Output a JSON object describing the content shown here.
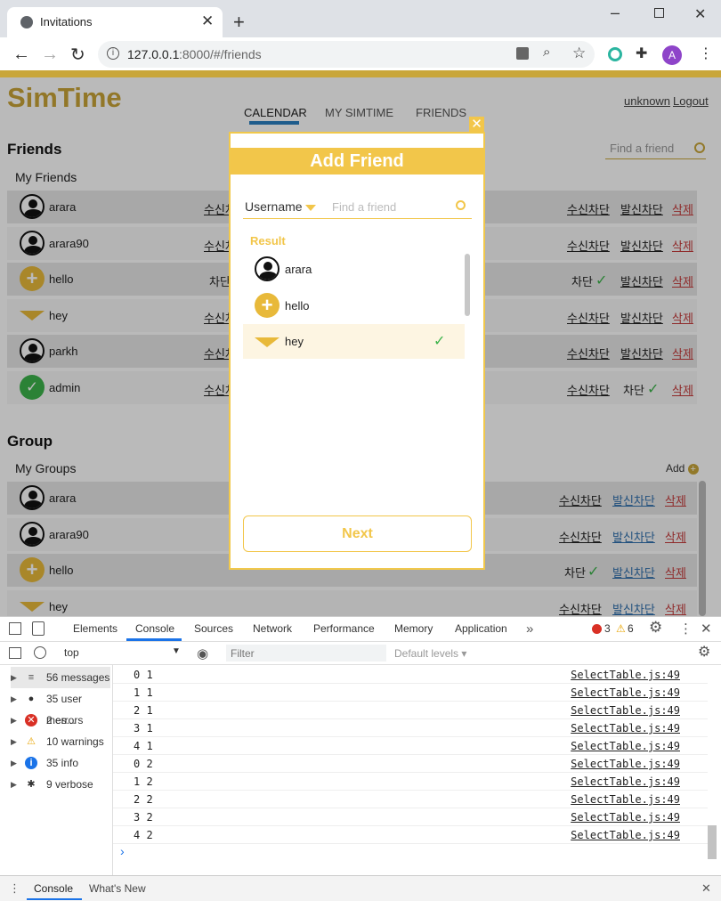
{
  "browser": {
    "tab_title": "Invitations",
    "url_host": "127.0.0.1",
    "url_path": ":8000/#/friends",
    "avatar_letter": "A"
  },
  "app": {
    "logo": "SimTime",
    "nav": [
      "CALENDAR",
      "MY SIMTIME",
      "FRIENDS"
    ],
    "user_link": "unknown",
    "logout_link": "Logout",
    "friends_title": "Friends",
    "my_friends": "My Friends",
    "find_placeholder": "Find a friend",
    "friends": [
      {
        "name": "arara",
        "avatar": "person",
        "a1": "수신차단",
        "b1": "수신차단",
        "b2": "발신차단",
        "b3": "삭제"
      },
      {
        "name": "arara90",
        "avatar": "person",
        "a1": "수신차",
        "b1": "수신차단",
        "b2": "발신차단",
        "b3": "삭제"
      },
      {
        "name": "hello",
        "avatar": "plus",
        "a1": "차단",
        "b1": "차단",
        "b2": "발신차단",
        "b3": "삭제"
      },
      {
        "name": "hey",
        "avatar": "arrow",
        "a1": "수신차",
        "b1": "수신차단",
        "b2": "발신차단",
        "b3": "삭제"
      },
      {
        "name": "parkh",
        "avatar": "person",
        "a1": "수신차",
        "b1": "수신차단",
        "b2": "발신차단",
        "b3": "삭제"
      },
      {
        "name": "admin",
        "avatar": "check",
        "a1": "수신차",
        "b1": "수신차단",
        "b2": "차단",
        "b3": "삭제"
      }
    ],
    "group_title": "Group",
    "my_groups": "My Groups",
    "add_label": "Add",
    "groups": [
      {
        "name": "arara",
        "avatar": "person",
        "b1": "수신차단",
        "b2": "발신차단",
        "b3": "삭제"
      },
      {
        "name": "arara90",
        "avatar": "person",
        "b1": "수신차단",
        "b2": "발신차단",
        "b3": "삭제"
      },
      {
        "name": "hello",
        "avatar": "plus",
        "b1": "차단",
        "b2": "발신차단",
        "b3": "삭제"
      },
      {
        "name": "hey",
        "avatar": "arrow",
        "b1": "수신차단",
        "b2": "발신차단",
        "b3": "삭제"
      }
    ]
  },
  "modal": {
    "title": "Add Friend",
    "select_label": "Username",
    "search_placeholder": "Find a friend",
    "result_label": "Result",
    "results": [
      {
        "name": "arara",
        "avatar": "person"
      },
      {
        "name": "hello",
        "avatar": "plus"
      },
      {
        "name": "hey",
        "avatar": "arrow",
        "selected": true
      }
    ],
    "next_label": "Next"
  },
  "devtools": {
    "tabs": [
      "Elements",
      "Console",
      "Sources",
      "Network",
      "Performance",
      "Memory",
      "Application"
    ],
    "more": "»",
    "errors": "3",
    "warnings": "6",
    "context": "top",
    "filter_placeholder": "Filter",
    "levels": "Default levels",
    "sidebar": [
      {
        "label": "56 messages",
        "icon": "list"
      },
      {
        "label": "35 user mes...",
        "icon": "user"
      },
      {
        "label": "2 errors",
        "icon": "error"
      },
      {
        "label": "10 warnings",
        "icon": "warning"
      },
      {
        "label": "35 info",
        "icon": "info"
      },
      {
        "label": "9 verbose",
        "icon": "bug"
      }
    ],
    "logs": [
      {
        "text": "0 1",
        "src": "SelectTable.js:49"
      },
      {
        "text": "1 1",
        "src": "SelectTable.js:49"
      },
      {
        "text": "2 1",
        "src": "SelectTable.js:49"
      },
      {
        "text": "3 1",
        "src": "SelectTable.js:49"
      },
      {
        "text": "4 1",
        "src": "SelectTable.js:49"
      },
      {
        "text": "0 2",
        "src": "SelectTable.js:49"
      },
      {
        "text": "1 2",
        "src": "SelectTable.js:49"
      },
      {
        "text": "2 2",
        "src": "SelectTable.js:49"
      },
      {
        "text": "3 2",
        "src": "SelectTable.js:49"
      },
      {
        "text": "4 2",
        "src": "SelectTable.js:49"
      }
    ],
    "prompt": "›",
    "drawer_tabs": [
      "Console",
      "What's New"
    ]
  }
}
